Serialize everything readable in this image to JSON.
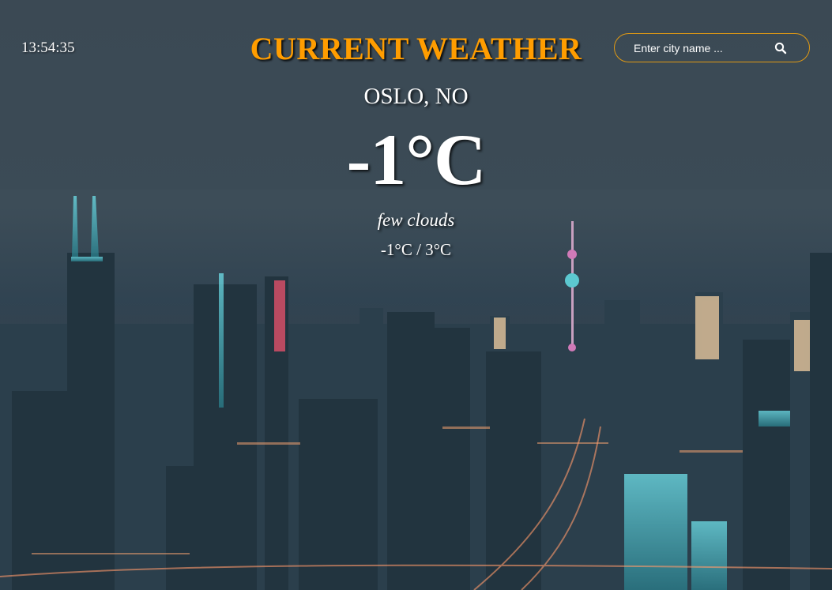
{
  "header": {
    "clock": "13:54:35",
    "title": "CURRENT WEATHER",
    "search": {
      "placeholder": "Enter city name ...",
      "value": "",
      "icon": "search-icon"
    }
  },
  "weather": {
    "location": "OSLO, NO",
    "temperature": "-1°C",
    "description": "few clouds",
    "range": "-1°C / 3°C"
  },
  "colors": {
    "accent": "#ff9d00",
    "text": "#ffffff",
    "search_border": "#e09a14"
  }
}
